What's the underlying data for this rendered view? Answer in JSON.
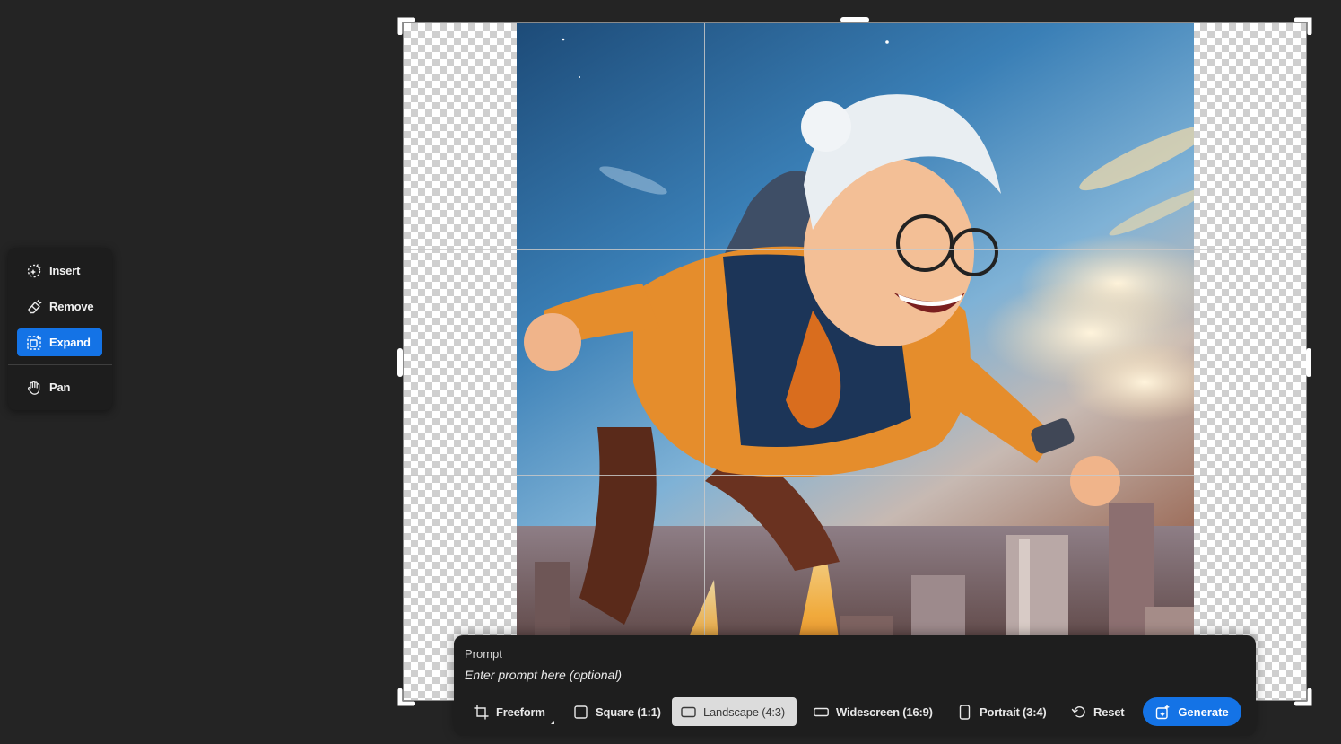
{
  "tools": {
    "insert": "Insert",
    "remove": "Remove",
    "expand": "Expand",
    "pan": "Pan",
    "active": "expand"
  },
  "prompt": {
    "label": "Prompt",
    "placeholder": "Enter prompt here (optional)",
    "value": ""
  },
  "aspect_ratios": [
    {
      "label": "Freeform"
    },
    {
      "label": "Square (1:1)"
    },
    {
      "label": "Landscape (4:3)"
    },
    {
      "label": "Widescreen (16:9)"
    },
    {
      "label": "Portrait (3:4)"
    }
  ],
  "selected_ratio": "Landscape (4:3)",
  "reset_label": "Reset",
  "generate_label": "Generate",
  "colors": {
    "accent": "#1473e6",
    "background": "#242424",
    "panel": "#1e1e1e"
  }
}
